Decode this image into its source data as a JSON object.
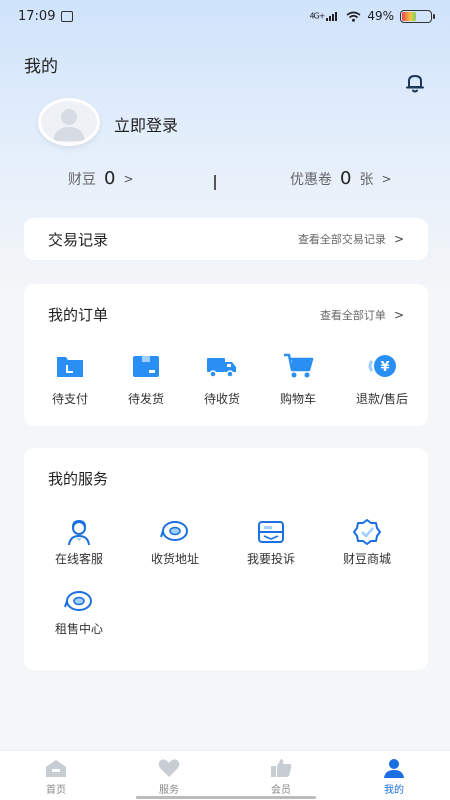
{
  "status_bar": {
    "time": "17:09",
    "network": "4G+",
    "battery_percent": "49%",
    "battery_level": 0.49
  },
  "header": {
    "title": "我的",
    "login_text": "立即登录"
  },
  "assets": {
    "beans_label": "财豆",
    "beans_value": "0",
    "coupon_label": "优惠卷",
    "coupon_value": "0",
    "coupon_unit": "张",
    "arrow": ">"
  },
  "transactions": {
    "title": "交易记录",
    "link": "查看全部交易记录",
    "arrow": ">"
  },
  "orders": {
    "title": "我的订单",
    "link": "查看全部订单",
    "arrow": ">",
    "items": [
      {
        "label": "待支付",
        "icon": "wallet-icon"
      },
      {
        "label": "待发货",
        "icon": "package-icon"
      },
      {
        "label": "待收货",
        "icon": "truck-icon"
      },
      {
        "label": "购物车",
        "icon": "cart-icon"
      },
      {
        "label": "退款/售后",
        "icon": "refund-icon"
      }
    ]
  },
  "services": {
    "title": "我的服务",
    "items": [
      {
        "label": "在线客服",
        "icon": "support-agent-icon"
      },
      {
        "label": "收货地址",
        "icon": "location-icon"
      },
      {
        "label": "我要投诉",
        "icon": "complaint-icon"
      },
      {
        "label": "财豆商城",
        "icon": "badge-check-icon"
      },
      {
        "label": "租售中心",
        "icon": "rental-center-icon"
      }
    ]
  },
  "bottom_nav": {
    "items": [
      {
        "label": "首页",
        "icon": "home-icon"
      },
      {
        "label": "服务",
        "icon": "heart-icon"
      },
      {
        "label": "会员",
        "icon": "thumb-up-icon"
      },
      {
        "label": "我的",
        "icon": "user-icon"
      }
    ],
    "active_index": 3
  },
  "colors": {
    "accent": "#1b6fe0",
    "icon_blue": "#2a8ff5",
    "bg": "#f5f6f8"
  }
}
